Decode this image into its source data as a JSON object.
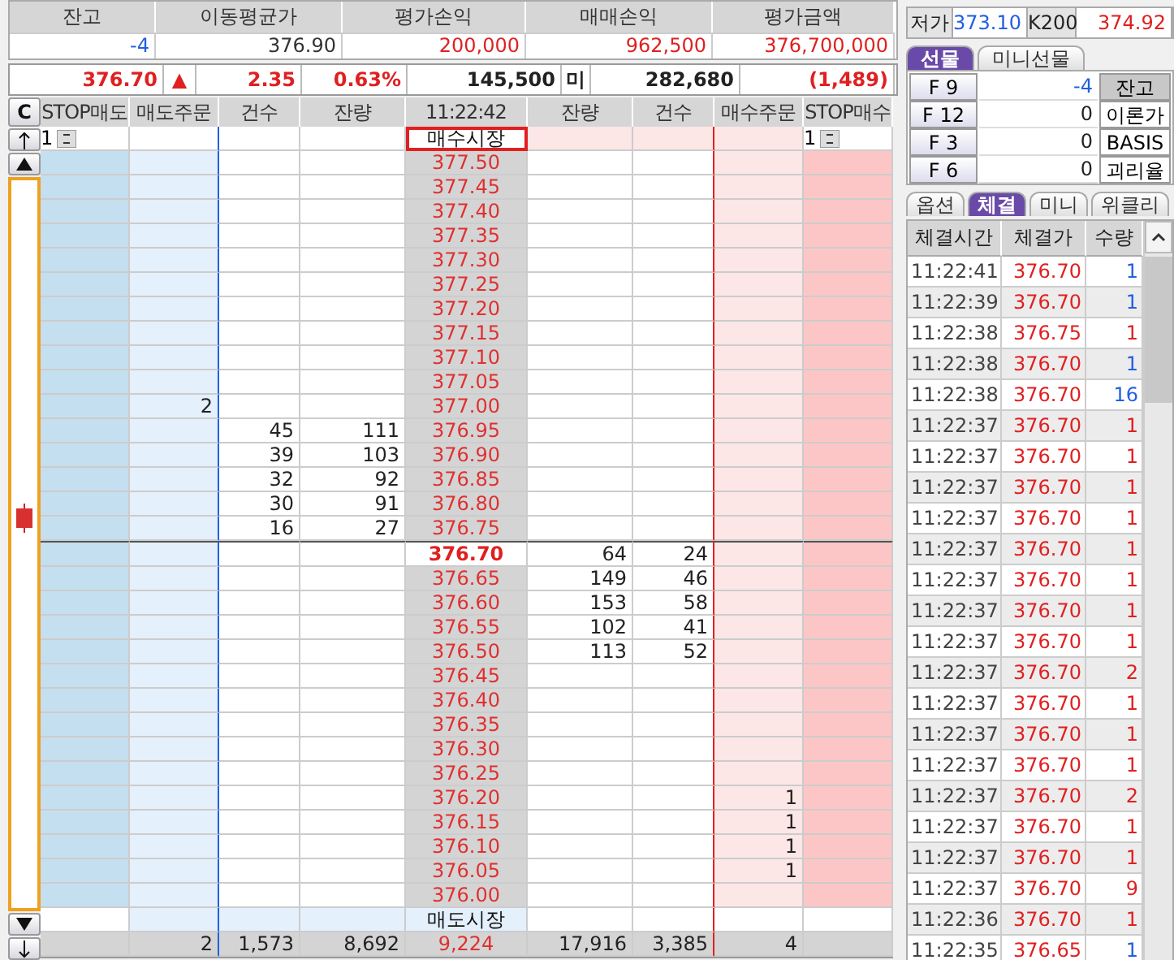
{
  "summary": {
    "headers": [
      "잔고",
      "이동평균가",
      "평가손익",
      "매매손익",
      "평가금액"
    ],
    "values": [
      {
        "text": "-4",
        "color": "#2060e0"
      },
      {
        "text": "376.90",
        "color": "#333333"
      },
      {
        "text": "200,000",
        "color": "#e02020"
      },
      {
        "text": "962,500",
        "color": "#e02020"
      },
      {
        "text": "376,700,000",
        "color": "#e02020"
      }
    ]
  },
  "price_bar": {
    "price": "376.70",
    "arrow": "▲",
    "change": "2.35",
    "rate": "0.63%",
    "volume": "145,500",
    "open_interest_label": "미",
    "open_interest": "282,680",
    "oi_change": "(1,489)"
  },
  "order_book": {
    "clear_button": "C",
    "columns": [
      "STOP매도",
      "매도주문",
      "건수",
      "잔량",
      "11:22:42",
      "잔량",
      "건수",
      "매수주문",
      "STOP매수"
    ],
    "rows": [
      {
        "kind": "buy_market",
        "stop_sell": "1",
        "price": "매수시장",
        "stop_buy": "1"
      },
      {
        "kind": "level",
        "price": "377.50"
      },
      {
        "kind": "level",
        "price": "377.45"
      },
      {
        "kind": "level",
        "price": "377.40"
      },
      {
        "kind": "level",
        "price": "377.35"
      },
      {
        "kind": "level",
        "price": "377.30"
      },
      {
        "kind": "level",
        "price": "377.25"
      },
      {
        "kind": "level",
        "price": "377.20"
      },
      {
        "kind": "level",
        "price": "377.15"
      },
      {
        "kind": "level",
        "price": "377.10"
      },
      {
        "kind": "level",
        "price": "377.05"
      },
      {
        "kind": "level",
        "sell_order": "2",
        "price": "377.00"
      },
      {
        "kind": "level",
        "sell_count": "45",
        "sell_qty": "111",
        "price": "376.95"
      },
      {
        "kind": "level",
        "sell_count": "39",
        "sell_qty": "103",
        "price": "376.90"
      },
      {
        "kind": "level",
        "sell_count": "32",
        "sell_qty": "92",
        "price": "376.85"
      },
      {
        "kind": "level",
        "sell_count": "30",
        "sell_qty": "91",
        "price": "376.80"
      },
      {
        "kind": "level",
        "sell_count": "16",
        "sell_qty": "27",
        "price": "376.75"
      },
      {
        "kind": "current",
        "price": "376.70",
        "buy_qty": "64",
        "buy_count": "24"
      },
      {
        "kind": "level",
        "price": "376.65",
        "buy_qty": "149",
        "buy_count": "46"
      },
      {
        "kind": "level",
        "price": "376.60",
        "buy_qty": "153",
        "buy_count": "58"
      },
      {
        "kind": "level",
        "price": "376.55",
        "buy_qty": "102",
        "buy_count": "41"
      },
      {
        "kind": "level",
        "price": "376.50",
        "buy_qty": "113",
        "buy_count": "52"
      },
      {
        "kind": "level",
        "price": "376.45"
      },
      {
        "kind": "level",
        "price": "376.40"
      },
      {
        "kind": "level",
        "price": "376.35"
      },
      {
        "kind": "level",
        "price": "376.30"
      },
      {
        "kind": "level",
        "price": "376.25"
      },
      {
        "kind": "level",
        "price": "376.20",
        "buy_order": "1"
      },
      {
        "kind": "level",
        "price": "376.15",
        "buy_order": "1"
      },
      {
        "kind": "level",
        "price": "376.10",
        "buy_order": "1"
      },
      {
        "kind": "level",
        "price": "376.05",
        "buy_order": "1"
      },
      {
        "kind": "level",
        "price": "376.00"
      },
      {
        "kind": "sell_market",
        "price": "매도시장"
      }
    ],
    "totals": {
      "sell_order": "2",
      "sell_count": "1,573",
      "sell_qty": "8,692",
      "price": "9,224",
      "buy_qty": "17,916",
      "buy_count": "3,385",
      "buy_order": "4"
    }
  },
  "quote": {
    "low_label": "저가",
    "low": "373.10",
    "index_label": "K200",
    "index": "374.92"
  },
  "futures_tabs": [
    {
      "label": "선물",
      "selected": true
    },
    {
      "label": "미니선물",
      "selected": false
    }
  ],
  "futures": [
    {
      "code": "F 9",
      "value": "-4",
      "color": "#2060e0",
      "button": "잔고",
      "pressed": true
    },
    {
      "code": "F 12",
      "value": "0",
      "color": "#222222",
      "button": "이론가",
      "pressed": false
    },
    {
      "code": "F 3",
      "value": "0",
      "color": "#222222",
      "button": "BASIS",
      "pressed": false
    },
    {
      "code": "F 6",
      "value": "0",
      "color": "#222222",
      "button": "괴리율",
      "pressed": false
    }
  ],
  "trade_tabs": [
    {
      "label": "옵션",
      "selected": false
    },
    {
      "label": "체결",
      "selected": true
    },
    {
      "label": "미니",
      "selected": false
    },
    {
      "label": "위클리",
      "selected": false
    }
  ],
  "trades": {
    "columns": [
      "체결시간",
      "체결가",
      "수량"
    ],
    "rows": [
      {
        "time": "11:22:41",
        "price": "376.70",
        "qty": "1",
        "color": "#2060e0"
      },
      {
        "time": "11:22:39",
        "price": "376.70",
        "qty": "1",
        "color": "#2060e0"
      },
      {
        "time": "11:22:38",
        "price": "376.75",
        "qty": "1",
        "color": "#e02020"
      },
      {
        "time": "11:22:38",
        "price": "376.70",
        "qty": "1",
        "color": "#2060e0"
      },
      {
        "time": "11:22:38",
        "price": "376.70",
        "qty": "16",
        "color": "#2060e0"
      },
      {
        "time": "11:22:37",
        "price": "376.70",
        "qty": "1",
        "color": "#e02020"
      },
      {
        "time": "11:22:37",
        "price": "376.70",
        "qty": "1",
        "color": "#e02020"
      },
      {
        "time": "11:22:37",
        "price": "376.70",
        "qty": "1",
        "color": "#e02020"
      },
      {
        "time": "11:22:37",
        "price": "376.70",
        "qty": "1",
        "color": "#e02020"
      },
      {
        "time": "11:22:37",
        "price": "376.70",
        "qty": "1",
        "color": "#e02020"
      },
      {
        "time": "11:22:37",
        "price": "376.70",
        "qty": "1",
        "color": "#e02020"
      },
      {
        "time": "11:22:37",
        "price": "376.70",
        "qty": "1",
        "color": "#e02020"
      },
      {
        "time": "11:22:37",
        "price": "376.70",
        "qty": "1",
        "color": "#e02020"
      },
      {
        "time": "11:22:37",
        "price": "376.70",
        "qty": "2",
        "color": "#e02020"
      },
      {
        "time": "11:22:37",
        "price": "376.70",
        "qty": "1",
        "color": "#e02020"
      },
      {
        "time": "11:22:37",
        "price": "376.70",
        "qty": "1",
        "color": "#e02020"
      },
      {
        "time": "11:22:37",
        "price": "376.70",
        "qty": "1",
        "color": "#e02020"
      },
      {
        "time": "11:22:37",
        "price": "376.70",
        "qty": "2",
        "color": "#e02020"
      },
      {
        "time": "11:22:37",
        "price": "376.70",
        "qty": "1",
        "color": "#e02020"
      },
      {
        "time": "11:22:37",
        "price": "376.70",
        "qty": "1",
        "color": "#e02020"
      },
      {
        "time": "11:22:37",
        "price": "376.70",
        "qty": "9",
        "color": "#e02020"
      },
      {
        "time": "11:22:36",
        "price": "376.70",
        "qty": "1",
        "color": "#e02020"
      },
      {
        "time": "11:22:35",
        "price": "376.65",
        "qty": "1",
        "color": "#2060e0"
      }
    ]
  }
}
